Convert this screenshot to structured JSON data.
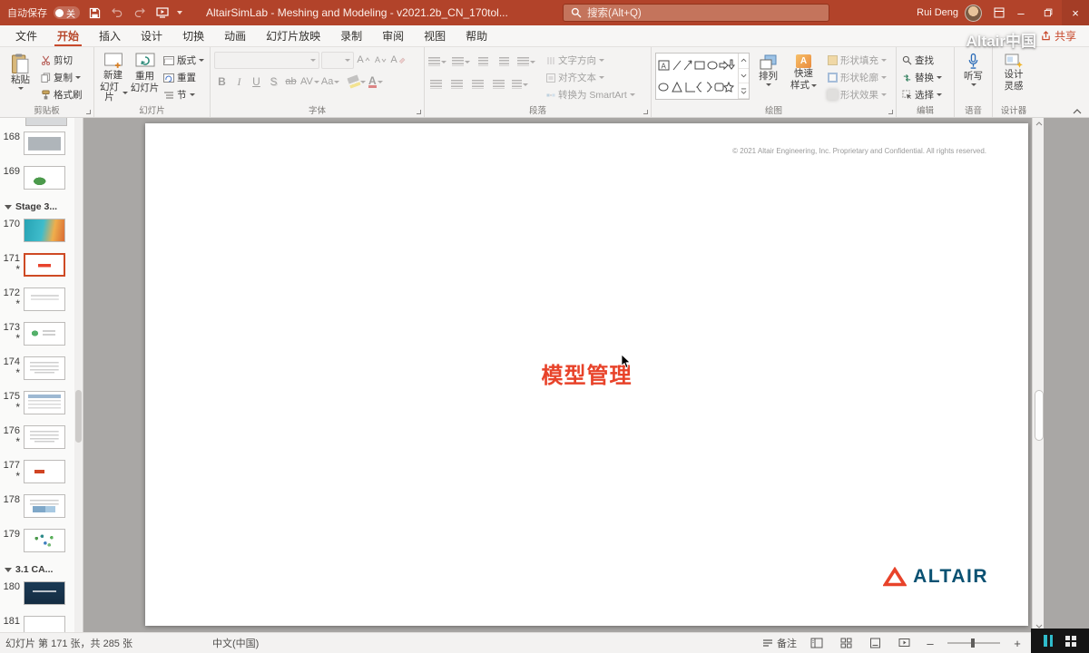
{
  "titlebar": {
    "autosave_label": "自动保存",
    "autosave_state": "关",
    "title": "AltairSimLab - Meshing and Modeling - v2021.2b_CN_170tol...",
    "search_placeholder": "搜索(Alt+Q)",
    "user_name": "Rui Deng"
  },
  "watermark": "Altair中国",
  "ribbon": {
    "tabs": [
      "文件",
      "开始",
      "插入",
      "设计",
      "切换",
      "动画",
      "幻灯片放映",
      "录制",
      "审阅",
      "视图",
      "帮助"
    ],
    "share_label": "共享",
    "groups": {
      "clipboard": {
        "label": "剪贴板",
        "paste": "粘贴",
        "cut": "剪切",
        "copy": "复制",
        "painter": "格式刷"
      },
      "slides": {
        "label": "幻灯片",
        "new1": "新建",
        "new2": "幻灯片",
        "reuse1": "重用",
        "reuse2": "幻灯片",
        "layout": "版式",
        "reset": "重置",
        "section": "节"
      },
      "font": {
        "label": "字体",
        "b": "B",
        "i": "I",
        "u": "U",
        "s": "S",
        "strike": "ab",
        "spacing": "AV",
        "case": "Aa",
        "grow": "A",
        "shrink": "A",
        "clear": "A",
        "color_a": "A"
      },
      "paragraph": {
        "label": "段落",
        "text_direction": "文字方向",
        "align_text": "对齐文本",
        "smartart": "转换为 SmartArt"
      },
      "drawing": {
        "label": "绘图",
        "arrange": "排列",
        "quick1": "快速",
        "quick2": "样式",
        "fill": "形状填充",
        "outline": "形状轮廓",
        "effects": "形状效果"
      },
      "editing": {
        "label": "编辑",
        "find": "查找",
        "replace": "替换",
        "select": "选择"
      },
      "voice": {
        "label": "语音",
        "dictate": "听写"
      },
      "designer": {
        "label": "设计器",
        "ideas1": "设计",
        "ideas2": "灵感"
      }
    }
  },
  "sidebar": {
    "items": [
      {
        "num": "168",
        "star": ""
      },
      {
        "num": "169",
        "star": ""
      },
      {
        "label": "Stage 3..."
      },
      {
        "num": "170",
        "star": ""
      },
      {
        "num": "171",
        "star": "*"
      },
      {
        "num": "172",
        "star": "*"
      },
      {
        "num": "173",
        "star": "*"
      },
      {
        "num": "174",
        "star": "*"
      },
      {
        "num": "175",
        "star": "*"
      },
      {
        "num": "176",
        "star": "*"
      },
      {
        "num": "177",
        "star": "*"
      },
      {
        "num": "178",
        "star": ""
      },
      {
        "num": "179",
        "star": ""
      },
      {
        "label": "3.1 CA..."
      },
      {
        "num": "180",
        "star": ""
      },
      {
        "num": "181",
        "star": ""
      }
    ]
  },
  "slide": {
    "copyright": "© 2021 Altair Engineering, Inc. Proprietary and Confidential. All rights reserved.",
    "title": "模型管理",
    "logo": "ALTAIR"
  },
  "statusbar": {
    "slide_counter": "幻灯片 第 171 张，共 285 张",
    "language": "中文(中国)",
    "notes": "备注"
  }
}
